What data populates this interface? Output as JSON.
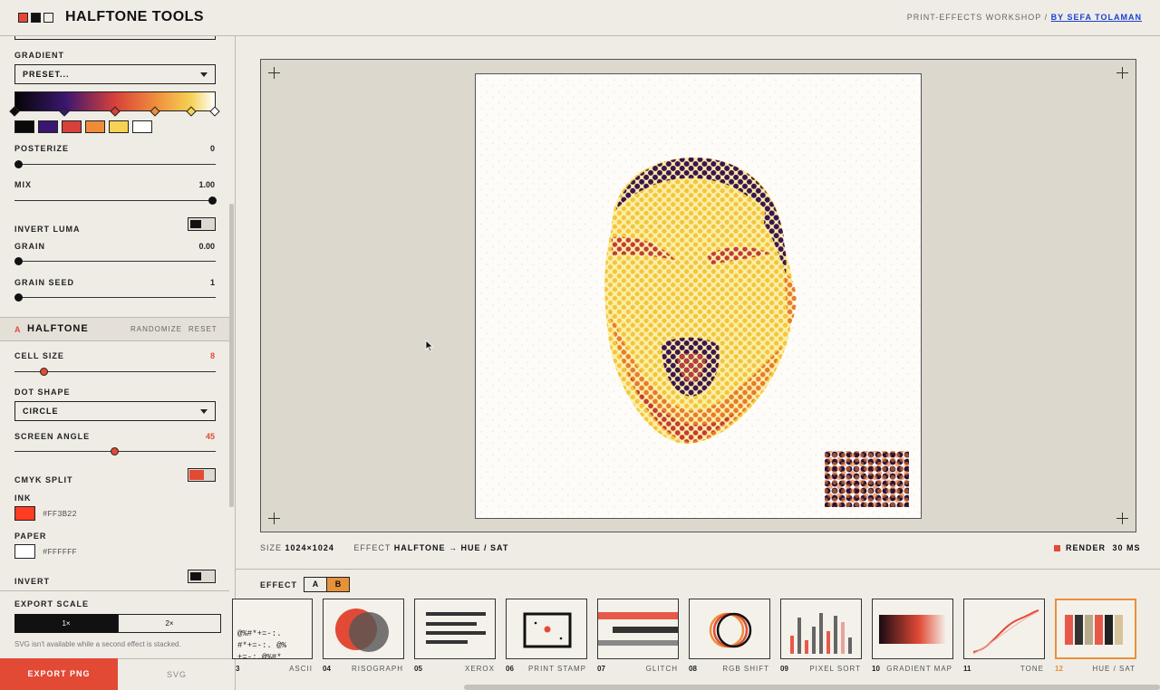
{
  "app": {
    "title": "HALFTONE TOOLS",
    "workshop_text": "PRINT-EFFECTS WORKSHOP /",
    "author_link": "BY SEFA TOLAMAN"
  },
  "colors": {
    "accent": "#e24a36",
    "orange": "#e8913b",
    "background": "#efece6"
  },
  "sidebar": {
    "gradient": {
      "label": "GRADIENT",
      "preset": "PRESET...",
      "swatches": [
        "#0a0a0a",
        "#3b1670",
        "#d7413a",
        "#ef8c3c",
        "#f6d154",
        "#ffffff"
      ]
    },
    "posterize": {
      "label": "POSTERIZE",
      "value": "0"
    },
    "mix": {
      "label": "MIX",
      "value": "1.00"
    },
    "invert_luma": {
      "label": "INVERT LUMA"
    },
    "grain": {
      "label": "GRAIN",
      "value": "0.00"
    },
    "grain_seed": {
      "label": "GRAIN SEED",
      "value": "1"
    },
    "halftone": {
      "badge": "A",
      "title": "HALFTONE",
      "randomize": "RANDOMIZE",
      "reset": "RESET"
    },
    "cell_size": {
      "label": "CELL SIZE",
      "value": "8"
    },
    "dot_shape": {
      "label": "DOT SHAPE",
      "value": "CIRCLE"
    },
    "screen_angle": {
      "label": "SCREEN ANGLE",
      "value": "45"
    },
    "cmyk_split": {
      "label": "CMYK SPLIT"
    },
    "ink": {
      "label": "INK",
      "hex": "#FF3B22",
      "color": "#ff3b22"
    },
    "paper": {
      "label": "PAPER",
      "hex": "#FFFFFF",
      "color": "#ffffff"
    },
    "invert": {
      "label": "INVERT"
    },
    "export_scale": {
      "label": "EXPORT SCALE",
      "opt1": "1×",
      "opt2": "2×"
    },
    "svg_note": "SVG isn't available while a second effect is stacked.",
    "export_png": "EXPORT PNG",
    "export_svg": "SVG"
  },
  "status": {
    "size_label": "SIZE",
    "size_value": "1024×1024",
    "effect_label": "EFFECT",
    "effect_value": "HALFTONE → HUE / SAT",
    "render_label": "RENDER",
    "render_value": "30 MS"
  },
  "effect_bar": {
    "label": "EFFECT",
    "tab_a": "A",
    "tab_b": "B"
  },
  "effects": [
    {
      "num": "3",
      "name": "ASCII"
    },
    {
      "num": "04",
      "name": "RISOGRAPH"
    },
    {
      "num": "05",
      "name": "XEROX"
    },
    {
      "num": "06",
      "name": "PRINT STAMP"
    },
    {
      "num": "07",
      "name": "GLITCH"
    },
    {
      "num": "08",
      "name": "RGB SHIFT"
    },
    {
      "num": "09",
      "name": "PIXEL SORT"
    },
    {
      "num": "10",
      "name": "GRADIENT MAP"
    },
    {
      "num": "11",
      "name": "TONE"
    },
    {
      "num": "12",
      "name": "HUE / SAT"
    }
  ],
  "ascii_preview": [
    "@%#*+=-:.",
    "#*+=-:. @%",
    "+=-:.@%#*",
    "%#*+= :.@"
  ]
}
